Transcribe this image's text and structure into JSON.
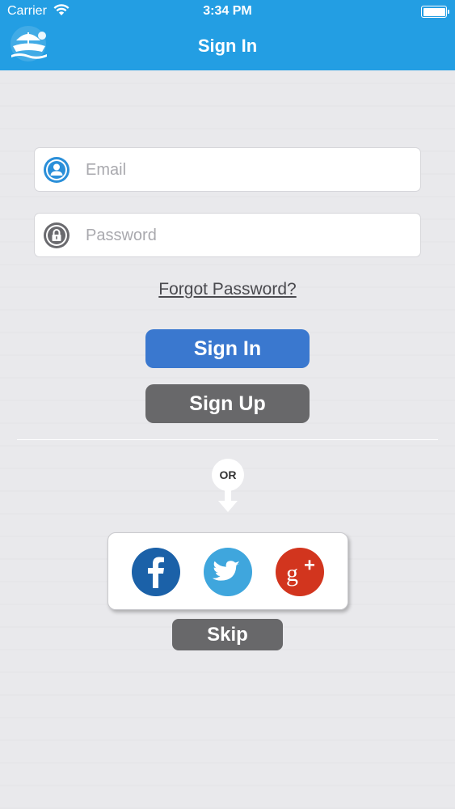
{
  "status_bar": {
    "carrier": "Carrier",
    "time": "3:34 PM"
  },
  "nav": {
    "title": "Sign In"
  },
  "form": {
    "email_placeholder": "Email",
    "password_placeholder": "Password",
    "forgot_label": "Forgot Password?",
    "signin_label": "Sign In",
    "signup_label": "Sign Up"
  },
  "social": {
    "or_label": "OR",
    "skip_label": "Skip"
  },
  "colors": {
    "nav_bar": "#239ee3",
    "signin_button": "#3a78cf",
    "signup_button": "#68686a",
    "facebook": "#1b61a8",
    "twitter": "#3fa6dd",
    "google_plus": "#d2351e"
  },
  "icons": {
    "logo": "app-logo",
    "email": "user-icon",
    "password": "lock-icon",
    "facebook": "facebook-icon",
    "twitter": "twitter-icon",
    "google_plus": "google-plus-icon"
  }
}
